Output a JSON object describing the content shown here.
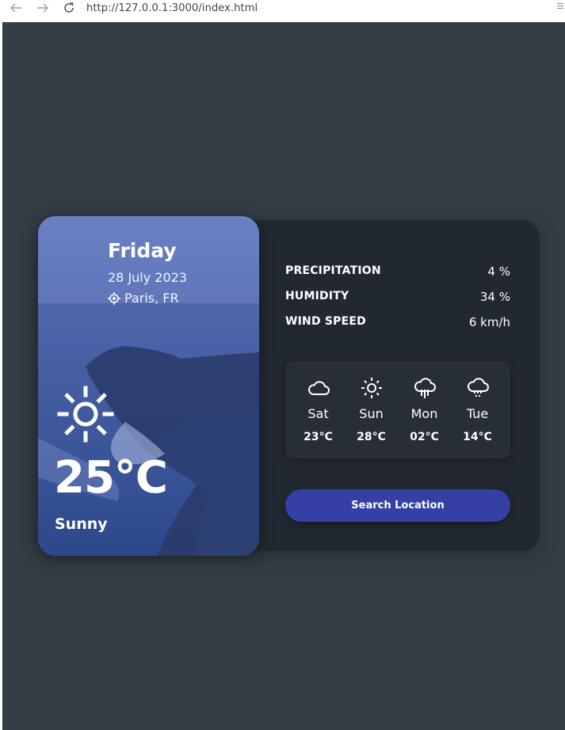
{
  "browser": {
    "url": "http://127.0.0.1:3000/index.html",
    "back_icon": "arrow-left-icon",
    "forward_icon": "arrow-right-icon",
    "reload_icon": "reload-icon"
  },
  "weather": {
    "day": "Friday",
    "date": "28 July 2023",
    "location": "Paris, FR",
    "temperature": "25°C",
    "description": "Sunny",
    "icon": "sun-icon"
  },
  "info": [
    {
      "title": "PRECIPITATION",
      "value": "4 %"
    },
    {
      "title": "HUMIDITY",
      "value": "34 %"
    },
    {
      "title": "WIND SPEED",
      "value": "6 km/h"
    }
  ],
  "week": [
    {
      "day": "Sat",
      "temp": "23°C",
      "icon": "cloud-icon"
    },
    {
      "day": "Sun",
      "temp": "28°C",
      "icon": "sun-icon"
    },
    {
      "day": "Mon",
      "temp": "02°C",
      "icon": "cloud-rain-icon"
    },
    {
      "day": "Tue",
      "temp": "14°C",
      "icon": "cloud-snow-icon"
    }
  ],
  "search_button": {
    "label": "Search Location"
  },
  "colors": {
    "page_background": "#343d46",
    "card_background": "#222831",
    "week_background": "#272e37",
    "button": "#3440a4"
  }
}
